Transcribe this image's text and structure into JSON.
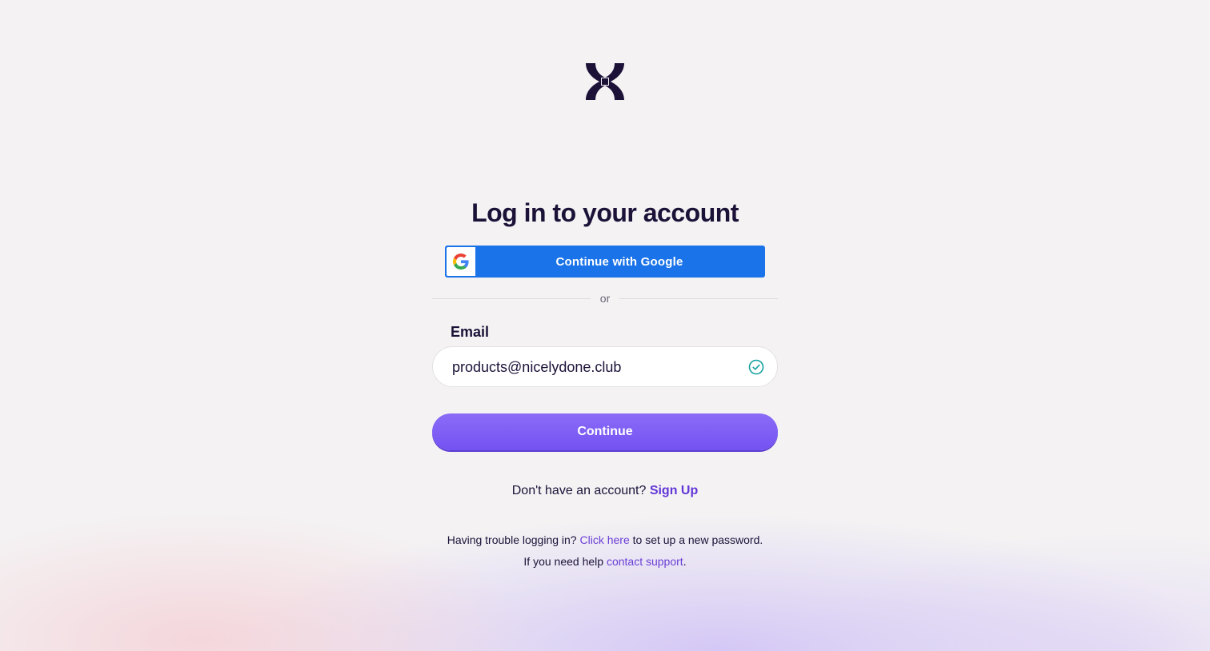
{
  "page": {
    "title": "Log in to your account"
  },
  "logo": {
    "icon": "x-brand-logo-icon",
    "color": "#1c1238"
  },
  "google_button": {
    "label": "Continue with Google",
    "icon": "google-g-icon",
    "color": "#1a73e8"
  },
  "divider": {
    "text": "or"
  },
  "email": {
    "label": "Email",
    "value": "products@nicelydone.club",
    "status_icon": "check-circle-icon",
    "status_color": "#17a0a0"
  },
  "continue_button": {
    "label": "Continue",
    "color": "#7452f2"
  },
  "signup": {
    "prompt": "Don't have an account?",
    "link": "Sign Up"
  },
  "help": {
    "trouble_prefix": "Having trouble logging in?",
    "click_here": "Click here",
    "trouble_suffix": "to set up a new password.",
    "support_prefix": "If you need help",
    "support_link": "contact support",
    "support_suffix": "."
  }
}
